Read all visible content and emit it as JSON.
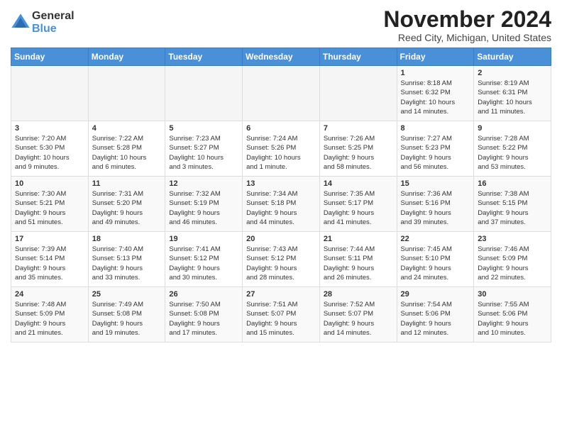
{
  "header": {
    "logo_line1": "General",
    "logo_line2": "Blue",
    "month": "November 2024",
    "location": "Reed City, Michigan, United States"
  },
  "weekdays": [
    "Sunday",
    "Monday",
    "Tuesday",
    "Wednesday",
    "Thursday",
    "Friday",
    "Saturday"
  ],
  "weeks": [
    [
      {
        "day": "",
        "info": ""
      },
      {
        "day": "",
        "info": ""
      },
      {
        "day": "",
        "info": ""
      },
      {
        "day": "",
        "info": ""
      },
      {
        "day": "",
        "info": ""
      },
      {
        "day": "1",
        "info": "Sunrise: 8:18 AM\nSunset: 6:32 PM\nDaylight: 10 hours\nand 14 minutes."
      },
      {
        "day": "2",
        "info": "Sunrise: 8:19 AM\nSunset: 6:31 PM\nDaylight: 10 hours\nand 11 minutes."
      }
    ],
    [
      {
        "day": "3",
        "info": "Sunrise: 7:20 AM\nSunset: 5:30 PM\nDaylight: 10 hours\nand 9 minutes."
      },
      {
        "day": "4",
        "info": "Sunrise: 7:22 AM\nSunset: 5:28 PM\nDaylight: 10 hours\nand 6 minutes."
      },
      {
        "day": "5",
        "info": "Sunrise: 7:23 AM\nSunset: 5:27 PM\nDaylight: 10 hours\nand 3 minutes."
      },
      {
        "day": "6",
        "info": "Sunrise: 7:24 AM\nSunset: 5:26 PM\nDaylight: 10 hours\nand 1 minute."
      },
      {
        "day": "7",
        "info": "Sunrise: 7:26 AM\nSunset: 5:25 PM\nDaylight: 9 hours\nand 58 minutes."
      },
      {
        "day": "8",
        "info": "Sunrise: 7:27 AM\nSunset: 5:23 PM\nDaylight: 9 hours\nand 56 minutes."
      },
      {
        "day": "9",
        "info": "Sunrise: 7:28 AM\nSunset: 5:22 PM\nDaylight: 9 hours\nand 53 minutes."
      }
    ],
    [
      {
        "day": "10",
        "info": "Sunrise: 7:30 AM\nSunset: 5:21 PM\nDaylight: 9 hours\nand 51 minutes."
      },
      {
        "day": "11",
        "info": "Sunrise: 7:31 AM\nSunset: 5:20 PM\nDaylight: 9 hours\nand 49 minutes."
      },
      {
        "day": "12",
        "info": "Sunrise: 7:32 AM\nSunset: 5:19 PM\nDaylight: 9 hours\nand 46 minutes."
      },
      {
        "day": "13",
        "info": "Sunrise: 7:34 AM\nSunset: 5:18 PM\nDaylight: 9 hours\nand 44 minutes."
      },
      {
        "day": "14",
        "info": "Sunrise: 7:35 AM\nSunset: 5:17 PM\nDaylight: 9 hours\nand 41 minutes."
      },
      {
        "day": "15",
        "info": "Sunrise: 7:36 AM\nSunset: 5:16 PM\nDaylight: 9 hours\nand 39 minutes."
      },
      {
        "day": "16",
        "info": "Sunrise: 7:38 AM\nSunset: 5:15 PM\nDaylight: 9 hours\nand 37 minutes."
      }
    ],
    [
      {
        "day": "17",
        "info": "Sunrise: 7:39 AM\nSunset: 5:14 PM\nDaylight: 9 hours\nand 35 minutes."
      },
      {
        "day": "18",
        "info": "Sunrise: 7:40 AM\nSunset: 5:13 PM\nDaylight: 9 hours\nand 33 minutes."
      },
      {
        "day": "19",
        "info": "Sunrise: 7:41 AM\nSunset: 5:12 PM\nDaylight: 9 hours\nand 30 minutes."
      },
      {
        "day": "20",
        "info": "Sunrise: 7:43 AM\nSunset: 5:12 PM\nDaylight: 9 hours\nand 28 minutes."
      },
      {
        "day": "21",
        "info": "Sunrise: 7:44 AM\nSunset: 5:11 PM\nDaylight: 9 hours\nand 26 minutes."
      },
      {
        "day": "22",
        "info": "Sunrise: 7:45 AM\nSunset: 5:10 PM\nDaylight: 9 hours\nand 24 minutes."
      },
      {
        "day": "23",
        "info": "Sunrise: 7:46 AM\nSunset: 5:09 PM\nDaylight: 9 hours\nand 22 minutes."
      }
    ],
    [
      {
        "day": "24",
        "info": "Sunrise: 7:48 AM\nSunset: 5:09 PM\nDaylight: 9 hours\nand 21 minutes."
      },
      {
        "day": "25",
        "info": "Sunrise: 7:49 AM\nSunset: 5:08 PM\nDaylight: 9 hours\nand 19 minutes."
      },
      {
        "day": "26",
        "info": "Sunrise: 7:50 AM\nSunset: 5:08 PM\nDaylight: 9 hours\nand 17 minutes."
      },
      {
        "day": "27",
        "info": "Sunrise: 7:51 AM\nSunset: 5:07 PM\nDaylight: 9 hours\nand 15 minutes."
      },
      {
        "day": "28",
        "info": "Sunrise: 7:52 AM\nSunset: 5:07 PM\nDaylight: 9 hours\nand 14 minutes."
      },
      {
        "day": "29",
        "info": "Sunrise: 7:54 AM\nSunset: 5:06 PM\nDaylight: 9 hours\nand 12 minutes."
      },
      {
        "day": "30",
        "info": "Sunrise: 7:55 AM\nSunset: 5:06 PM\nDaylight: 9 hours\nand 10 minutes."
      }
    ]
  ]
}
